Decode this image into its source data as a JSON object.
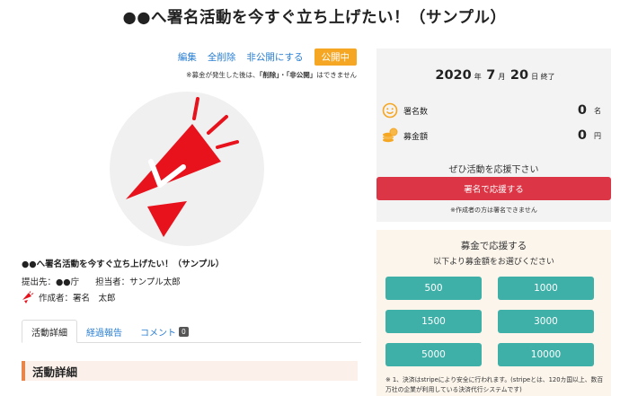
{
  "page": {
    "title": "●●へ署名活動を今すぐ立ち上げたい！（サンプル）"
  },
  "actions": {
    "edit": "編集",
    "delete_all": "全削除",
    "make_private": "非公開にする",
    "status_badge": "公開中",
    "note_prefix": "※募金が発生した後は、",
    "note_delete": "「削除」",
    "note_sep": "・",
    "note_private": "「非公開」",
    "note_suffix": "はできません"
  },
  "petition": {
    "title": "●●へ署名活動を今すぐ立ち上げたい！（サンプル）",
    "recipient": "提出先：●●庁",
    "manager": "担当者：サンプル太郎",
    "author": "作成者：署名　太郎"
  },
  "tabs": [
    {
      "label": "活動詳細"
    },
    {
      "label": "経過報告"
    },
    {
      "label": "コメント",
      "count": "0"
    }
  ],
  "section": {
    "heading": "活動詳細"
  },
  "deadline": {
    "year": "2020",
    "year_unit": "年",
    "month": "7",
    "month_unit": "月",
    "day": "20",
    "day_unit": "日",
    "suffix": "終了"
  },
  "stats": {
    "signatures_label": "署名数",
    "signatures_value": "0",
    "signatures_unit": "名",
    "donations_label": "募金額",
    "donations_value": "0",
    "donations_unit": "円"
  },
  "support": {
    "label": "ぜひ活動を応援下さい",
    "sign_button": "署名で応援する",
    "sign_note": "※作成者の方は署名できません"
  },
  "donate": {
    "title": "募金で応援する",
    "subtitle": "以下より募金額をお選びください",
    "amounts": [
      "500",
      "1000",
      "1500",
      "3000",
      "5000",
      "10000"
    ],
    "note": "※ 1、決済はstripeにより安全に行われます。(stripeとは、120カ国以上、数百万社の企業が利用している決済代行システムです)"
  },
  "colors": {
    "accent_red": "#dc3545",
    "teal": "#3fb0a8",
    "orange": "#f5a623",
    "link_blue": "#2a7fd4",
    "megaphone_red": "#e8121c"
  }
}
